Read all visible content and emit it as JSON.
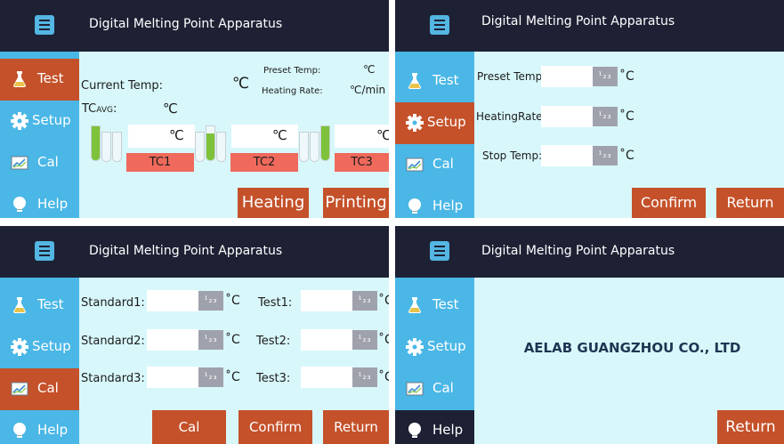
{
  "app_title": "Digital Melting Point Apparatus",
  "nav": {
    "test": "Test",
    "setup": "Setup",
    "cal": "Cal",
    "help": "Help"
  },
  "keypad_glyph": "¹₂₃",
  "icons": {
    "menu": "menu-icon",
    "test": "flask-icon",
    "setup": "gear-icon",
    "cal": "chart-icon",
    "help": "bulb-icon"
  },
  "colors": {
    "titlebar": "#1e2134",
    "sidebar": "#4ab7e6",
    "active": "#c4512a",
    "content": "#d8f7fb",
    "tc_label": "#ef6a5c",
    "tube_fill": "#7dc23a"
  },
  "test_screen": {
    "current_temp_label": "Current Temp:",
    "current_temp_unit": "℃",
    "preset_temp_label": "Preset Temp:",
    "preset_temp_unit": "℃",
    "heating_rate_label": "Heating Rate:",
    "heating_rate_unit": "℃/min",
    "tc_avg_label": "TC",
    "tc_avg_sub": "AVG",
    "tc_avg_colon": ":",
    "tc_avg_unit": "℃",
    "channels": [
      {
        "label": "TC1",
        "unit": "℃"
      },
      {
        "label": "TC2",
        "unit": "℃"
      },
      {
        "label": "TC3",
        "unit": "℃"
      }
    ],
    "heating_button": "Heating",
    "printing_button": "Printing"
  },
  "setup_screen": {
    "preset_temp_label": "Preset Temp:",
    "heating_rate_label": "HeatingRate:",
    "stop_temp_label": "Stop Temp:",
    "unit": "˚C",
    "confirm_button": "Confirm",
    "return_button": "Return"
  },
  "cal_screen": {
    "standard1_label": "Standard1:",
    "standard2_label": "Standard2:",
    "standard3_label": "Standard3:",
    "test1_label": "Test1:",
    "test2_label": "Test2:",
    "test3_label": "Test3:",
    "unit": "˚C",
    "cal_button": "Cal",
    "confirm_button": "Confirm",
    "return_button": "Return"
  },
  "help_screen": {
    "company": "AELAB GUANGZHOU CO., LTD",
    "return_button": "Return"
  }
}
